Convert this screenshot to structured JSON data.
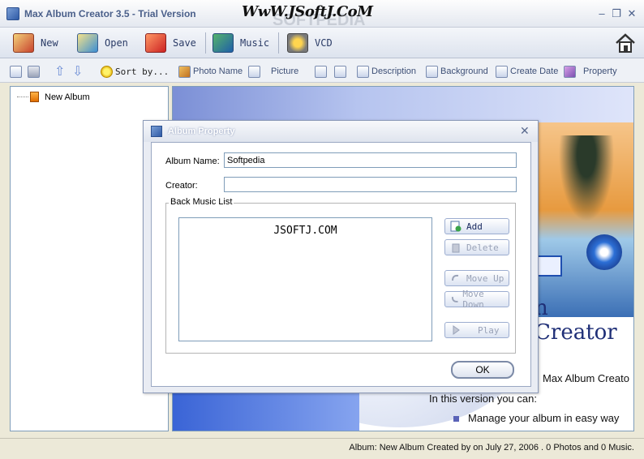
{
  "window": {
    "title": "Max Album Creator 3.5 - Trial Version",
    "watermark": "WwW.JSoftJ.CoM",
    "watermark2": "SOFTPEDIA"
  },
  "toolbar": {
    "new": "New",
    "open": "Open",
    "save": "Save",
    "music": "Music",
    "vcd": "VCD"
  },
  "subtoolbar": {
    "sort_by": "Sort by...",
    "photo_name": "Photo Name",
    "picture": "Picture",
    "description": "Description",
    "background": "Background",
    "create_date": "Create Date",
    "property": "Property"
  },
  "tree": {
    "root": "New Album"
  },
  "preview": {
    "creator_text": "n Creator",
    "line1": "Max Album Creato",
    "line2": "In this version you can:",
    "bullet1": "Manage your album in easy way"
  },
  "dialog": {
    "title": "Album Property",
    "album_name_label": "Album Name:",
    "album_name_value": "Softpedia",
    "creator_label": "Creator:",
    "creator_value": "",
    "group_label": "Back Music List",
    "music_items": [
      "JSOFTJ.COM"
    ],
    "add": "Add",
    "delete": "Delete",
    "move_up": "Move Up",
    "move_down": "Move Down",
    "play": "Play",
    "ok": "OK"
  },
  "status": {
    "text": "Album: New Album Created by  on July 27, 2006 . 0 Photos and 0 Music."
  }
}
